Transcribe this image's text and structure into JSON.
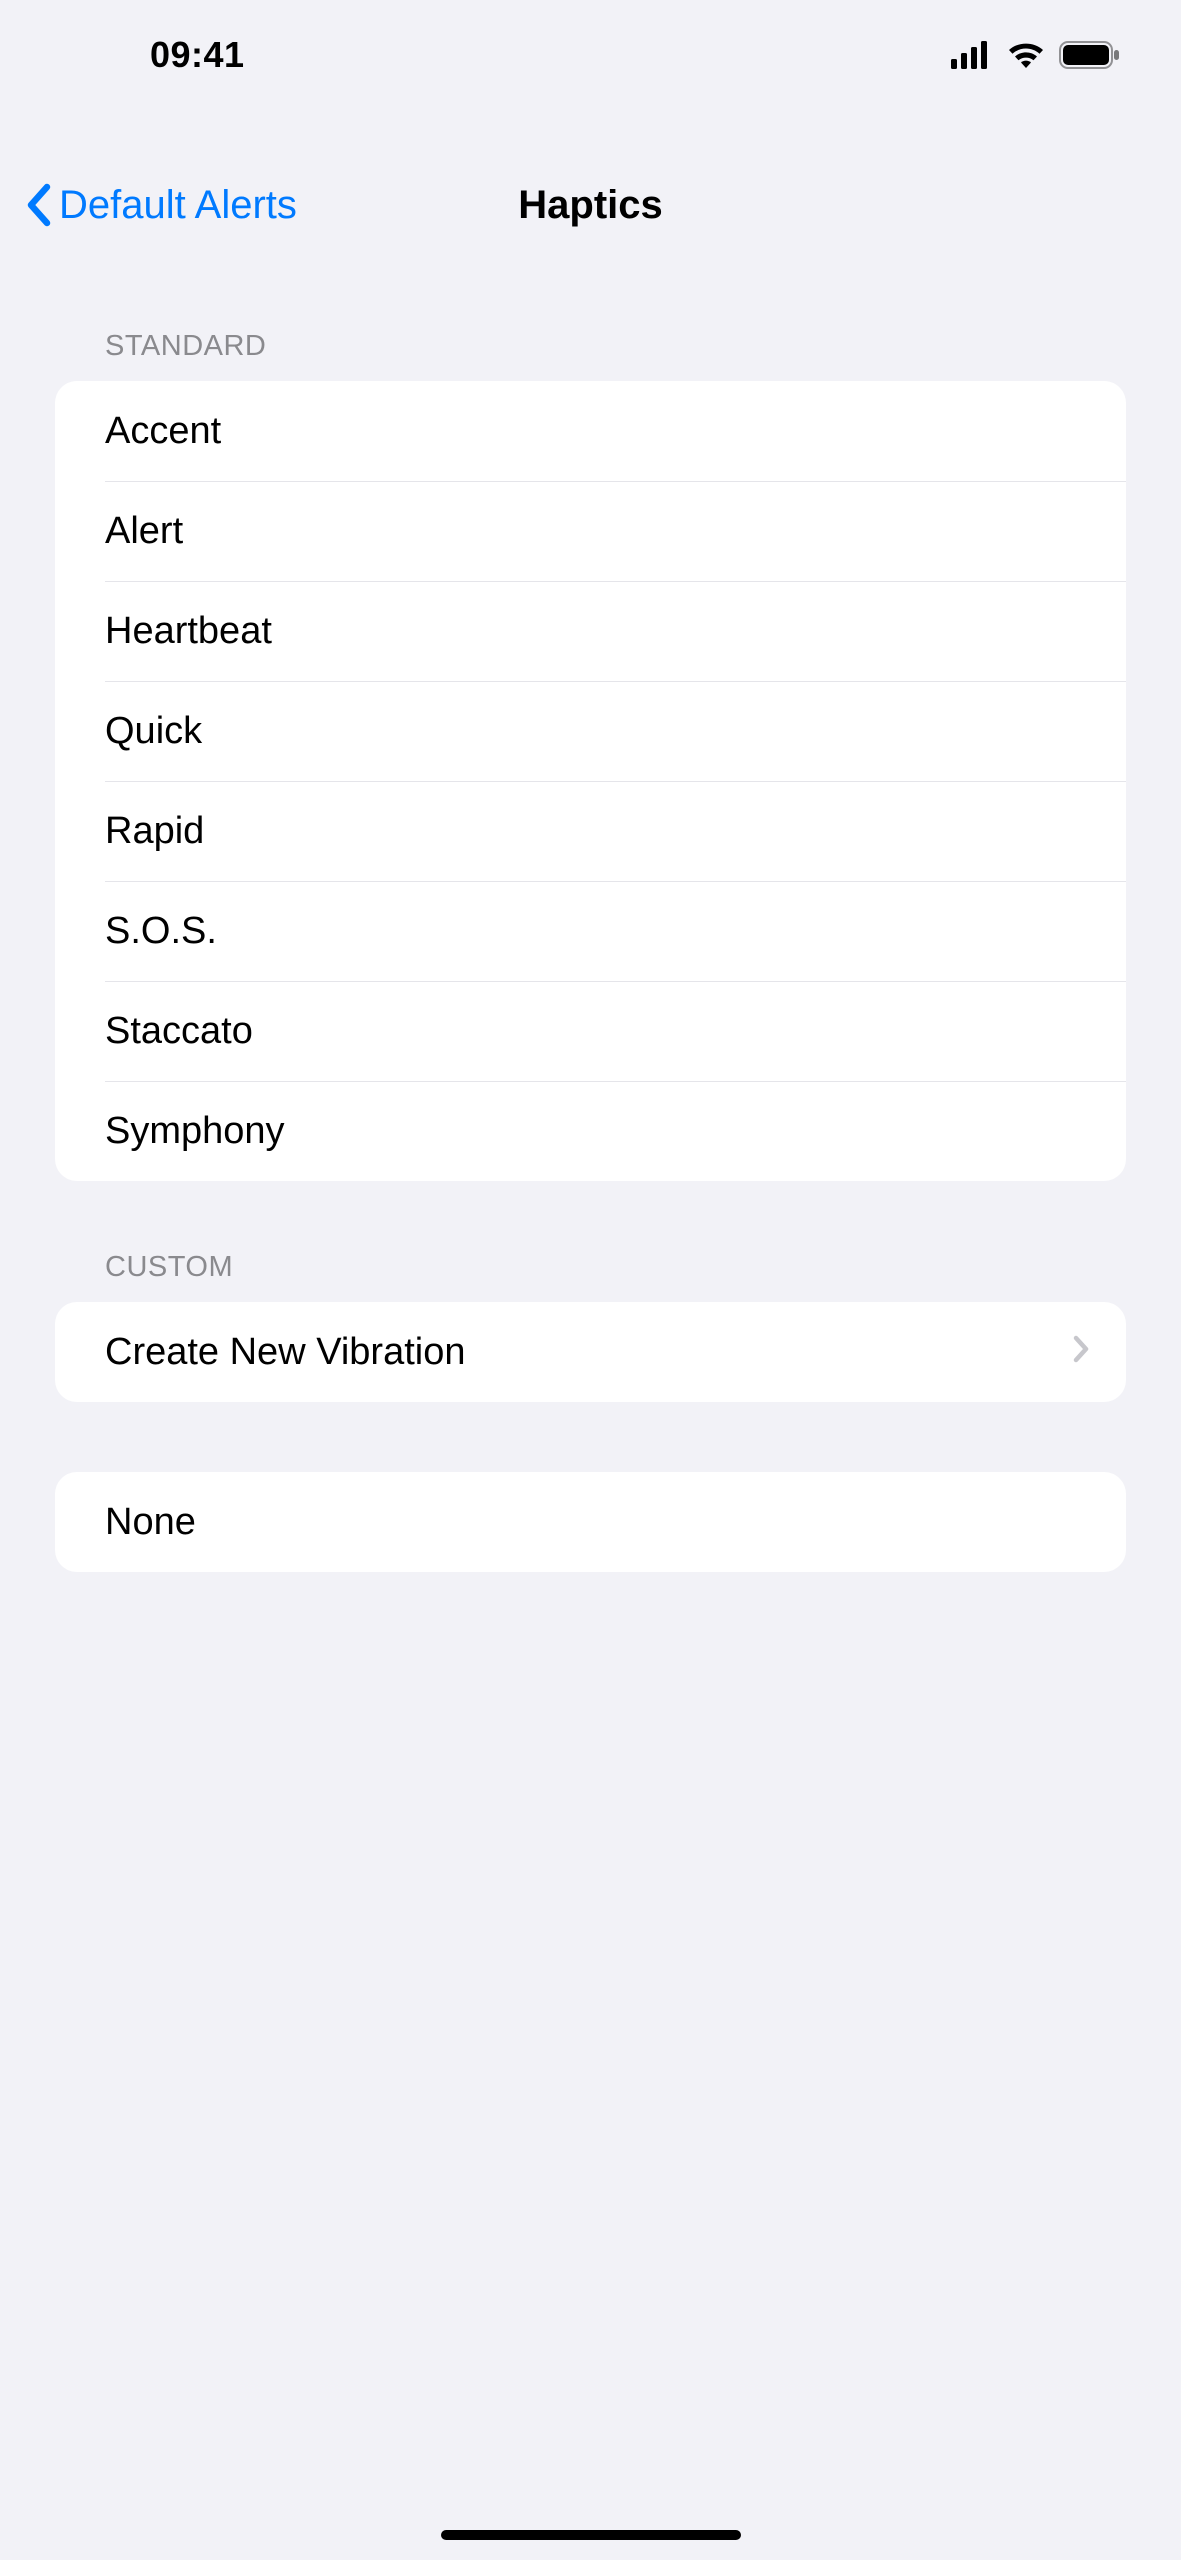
{
  "status_bar": {
    "time": "09:41"
  },
  "nav": {
    "back_label": "Default Alerts",
    "title": "Haptics"
  },
  "sections": {
    "standard": {
      "header": "Standard",
      "items": [
        "Accent",
        "Alert",
        "Heartbeat",
        "Quick",
        "Rapid",
        "S.O.S.",
        "Staccato",
        "Symphony"
      ]
    },
    "custom": {
      "header": "Custom",
      "create_label": "Create New Vibration"
    },
    "none": {
      "label": "None"
    }
  }
}
